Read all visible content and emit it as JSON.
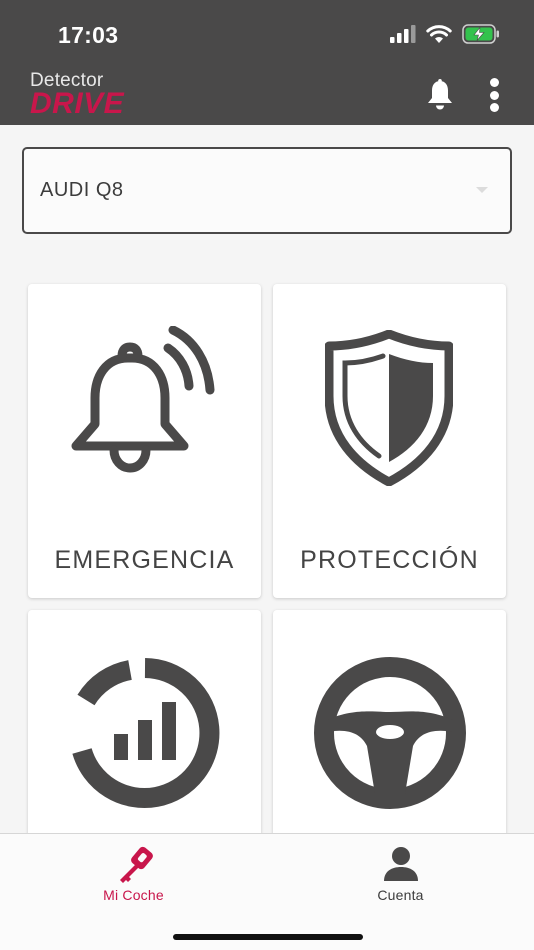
{
  "status_bar": {
    "time": "17:03"
  },
  "header": {
    "logo_line1": "Detector",
    "logo_line2": "DRIVE"
  },
  "vehicle_select": {
    "selected_value": "AUDI Q8"
  },
  "cards": [
    {
      "label": "EMERGENCIA",
      "icon": "alarm-bell-icon"
    },
    {
      "label": "PROTECCIÓN",
      "icon": "shield-icon"
    },
    {
      "label": "",
      "icon": "signal-gauge-icon"
    },
    {
      "label": "",
      "icon": "steering-wheel-icon"
    }
  ],
  "tabbar": {
    "tabs": [
      {
        "label": "Mi Coche",
        "icon": "car-key-icon",
        "active": true
      },
      {
        "label": "Cuenta",
        "icon": "user-icon",
        "active": false
      }
    ]
  },
  "colors": {
    "header_bg": "#4a4949",
    "brand_accent": "#c8164b",
    "icon_gray": "#4a4949"
  }
}
